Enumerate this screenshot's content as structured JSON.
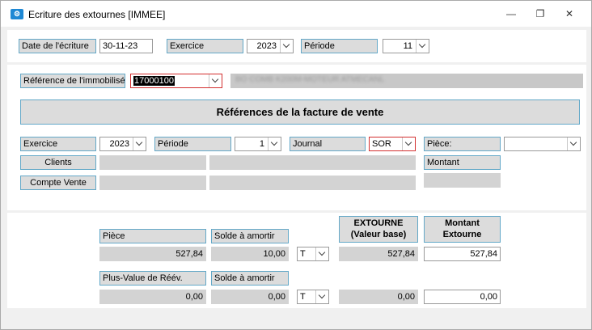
{
  "window": {
    "title": "Ecriture des extournes [IMMEE]"
  },
  "header": {
    "date_label": "Date de l'écriture",
    "date_value": "30-11-23",
    "exercice_label": "Exercice",
    "exercice_value": "2023",
    "periode_label": "Période",
    "periode_value": "11"
  },
  "immobilise": {
    "label": "Référence de l'immobilisé",
    "value": "17000100",
    "description": "BO COMB K200M-MOTEUR ATMECANL"
  },
  "facture": {
    "title": "Références de la facture de vente",
    "exercice_label": "Exercice",
    "exercice_value": "2023",
    "periode_label": "Période",
    "periode_value": "1",
    "journal_label": "Journal",
    "journal_value": "SOR",
    "piece_label": "Pièce:",
    "piece_value": "",
    "clients_label": "Clients",
    "montant_label": "Montant",
    "compte_vente_label": "Compte Vente"
  },
  "extourne": {
    "extourne_header": "EXTOURNE (Valeur base)",
    "montant_header": "Montant Extourne",
    "row1": {
      "label": "Pièce",
      "solde_label": "Solde à amortir",
      "piece_value": "527,84",
      "solde_value": "10,00",
      "type_value": "T",
      "extourne_value": "527,84",
      "montant_value": "527,84"
    },
    "row2": {
      "label": "Plus-Value de Réév.",
      "solde_label": "Solde à amortir",
      "piece_value": "0,00",
      "solde_value": "0,00",
      "type_value": "T",
      "extourne_value": "0,00",
      "montant_value": "0,00"
    }
  },
  "colors": {
    "label_border": "#63a8c8",
    "label_bg": "#dcdcdc",
    "error_border": "#d32f2f",
    "app_icon": "#1e88d4"
  }
}
